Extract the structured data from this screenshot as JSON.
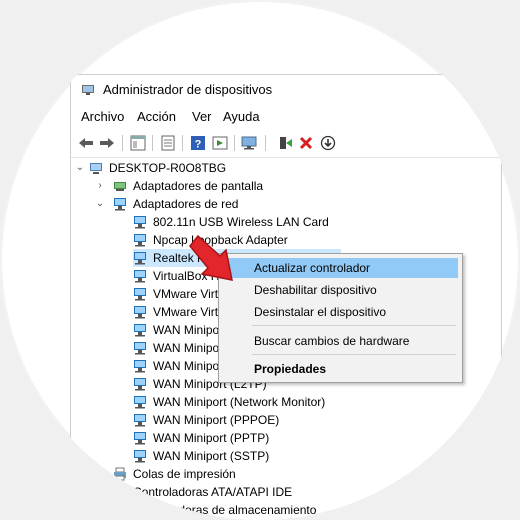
{
  "window": {
    "title": "Administrador de dispositivos"
  },
  "menu": {
    "archivo": "Archivo",
    "accion": "Acción",
    "ver": "Ver",
    "ayuda": "Ayuda"
  },
  "tree": {
    "root": "DESKTOP-R0O8TBG",
    "display_adapters": "Adaptadores de pantalla",
    "network_adapters": "Adaptadores de red",
    "devices": [
      "802.11n USB Wireless LAN Card",
      "Npcap Loopback Adapter",
      "Realtek PCIe",
      "VirtualBox H",
      "VMware Virt",
      "VMware Virt",
      "WAN Miniport",
      "WAN Miniport",
      "WAN Miniport",
      "WAN Miniport (L2TP)",
      "WAN Miniport (Network Monitor)",
      "WAN Miniport (PPPOE)",
      "WAN Miniport (PPTP)",
      "WAN Miniport (SSTP)"
    ],
    "print_queues": "Colas de impresión",
    "ata_controllers": "Controladoras ATA/ATAPI IDE",
    "storage_controllers": "Controladoras de almacenamiento"
  },
  "context_menu": {
    "update_driver": "Actualizar controlador",
    "disable_device": "Deshabilitar dispositivo",
    "uninstall_device": "Desinstalar el dispositivo",
    "scan_hardware": "Buscar cambios de hardware",
    "properties": "Propiedades"
  },
  "colors": {
    "highlight": "#91c9f7",
    "network_icon": "#1e73be",
    "arrow": "#e3262b"
  },
  "icons": [
    "back-arrow-icon",
    "forward-arrow-icon",
    "console-tree-icon",
    "properties-icon",
    "help-icon",
    "view-icon",
    "monitor-scan-icon",
    "enable-device-icon",
    "uninstall-x-icon",
    "update-driver-icon"
  ]
}
